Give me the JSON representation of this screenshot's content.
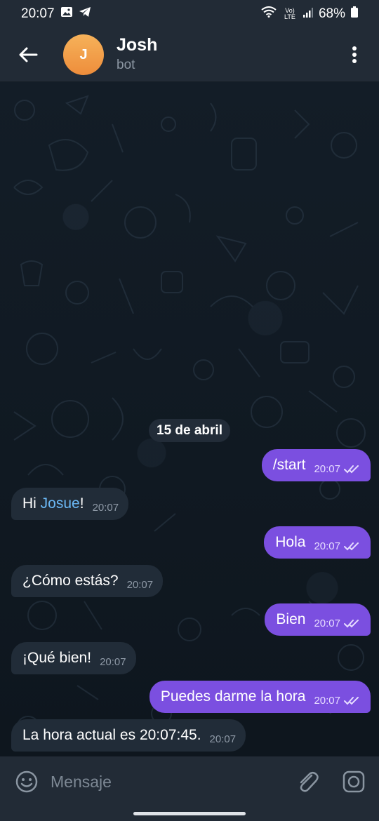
{
  "status_bar": {
    "time": "20:07",
    "network": "Vo) LTE",
    "battery": "68%"
  },
  "header": {
    "avatar_letter": "J",
    "title": "Josh",
    "subtitle": "bot"
  },
  "chat": {
    "date_chip": "15 de abril",
    "messages": [
      {
        "direction": "out",
        "text": "/start",
        "time": "20:07"
      },
      {
        "direction": "in",
        "prefix": "Hi ",
        "mention": "Josue",
        "suffix": "!",
        "time": "20:07"
      },
      {
        "direction": "out",
        "text": "Hola",
        "time": "20:07"
      },
      {
        "direction": "in",
        "text": "¿Cómo estás?",
        "time": "20:07"
      },
      {
        "direction": "out",
        "text": "Bien",
        "time": "20:07"
      },
      {
        "direction": "in",
        "text": "¡Qué bien!",
        "time": "20:07"
      },
      {
        "direction": "out",
        "text": "Puedes darme la hora",
        "time": "20:07"
      },
      {
        "direction": "in",
        "text": "La hora actual es 20:07:45.",
        "time": "20:07"
      }
    ]
  },
  "input": {
    "placeholder": "Mensaje"
  },
  "colors": {
    "outgoing_bubble": "#7b4fe0",
    "incoming_bubble": "#212c38",
    "mention": "#6bb8f5",
    "avatar": "#ee8d3b",
    "bar": "#222b36"
  },
  "icons": [
    "back-arrow-icon",
    "more-vert-icon",
    "emoji-icon",
    "attach-icon",
    "camera-icon",
    "double-check-icon",
    "image-icon",
    "telegram-icon",
    "wifi-icon",
    "signal-icon",
    "battery-icon"
  ]
}
